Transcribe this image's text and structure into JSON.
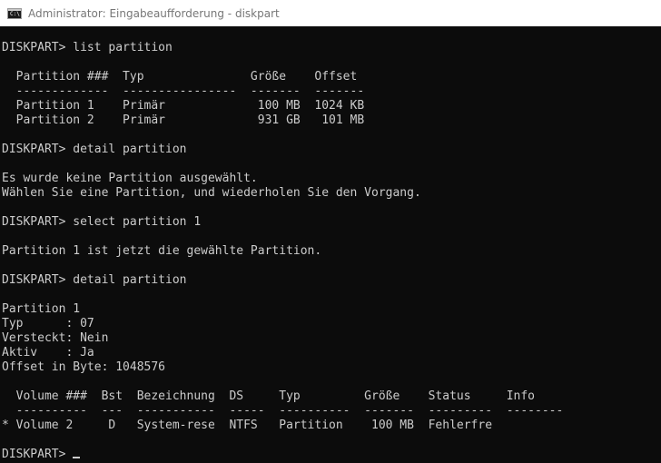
{
  "window": {
    "title": "Administrator: Eingabeaufforderung - diskpart",
    "icon": "cmd-icon",
    "icon_prompt": "C:\\"
  },
  "console": {
    "lines": [
      "DISKPART> list partition",
      "",
      "  Partition ###  Typ               Größe    Offset",
      "  -------------  ----------------  -------  -------",
      "  Partition 1    Primär             100 MB  1024 KB",
      "  Partition 2    Primär             931 GB   101 MB",
      "",
      "DISKPART> detail partition",
      "",
      "Es wurde keine Partition ausgewählt.",
      "Wählen Sie eine Partition, und wiederholen Sie den Vorgang.",
      "",
      "DISKPART> select partition 1",
      "",
      "Partition 1 ist jetzt die gewählte Partition.",
      "",
      "DISKPART> detail partition",
      "",
      "Partition 1",
      "Typ      : 07",
      "Versteckt: Nein",
      "Aktiv    : Ja",
      "Offset in Byte: 1048576",
      "",
      "  Volume ###  Bst  Bezeichnung  DS     Typ         Größe    Status     Info",
      "  ----------  ---  -----------  -----  ----------  -------  ---------  --------",
      "* Volume 2     D   System-rese  NTFS   Partition    100 MB  Fehlerfre",
      "",
      "DISKPART> "
    ]
  }
}
